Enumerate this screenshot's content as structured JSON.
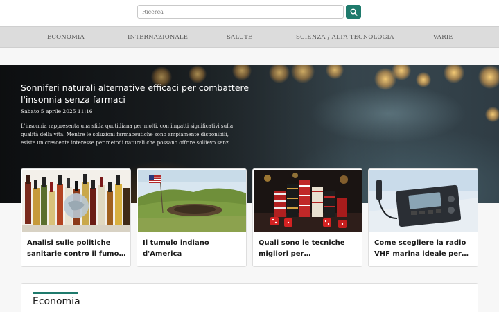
{
  "search": {
    "placeholder": "Ricerca",
    "button_icon": "search-icon",
    "accent_color": "#1e7a6c"
  },
  "nav": {
    "items": [
      {
        "label": "ECONOMIA"
      },
      {
        "label": "INTERNAZIONALE"
      },
      {
        "label": "SALUTE"
      },
      {
        "label": "SCIENZA / ALTA TECNOLOGIA"
      },
      {
        "label": "VARIE"
      }
    ]
  },
  "hero": {
    "title": "Sonniferi naturali alternative efficaci per combattere l'insonnia senza farmaci",
    "date": "Sabato 5 aprile 2025 11:16",
    "excerpt": "L'insonnia rappresenta una sfida quotidiana per molti, con impatti significativi sulla qualità della vita. Mentre le soluzioni farmaceutiche sono ampiamente disponibili, esiste un crescente interesse per metodi naturali che possano offrire sollievo senz..."
  },
  "cards": [
    {
      "title": "Analisi sulle politiche sanitarie contro il fumo n..."
    },
    {
      "title": "Il tumulo indiano d'America"
    },
    {
      "title": "Quali sono le tecniche migliori per massimizzare..."
    },
    {
      "title": "Come scegliere la radio VHF marina ideale per le..."
    }
  ],
  "section": {
    "title": "Economia"
  }
}
